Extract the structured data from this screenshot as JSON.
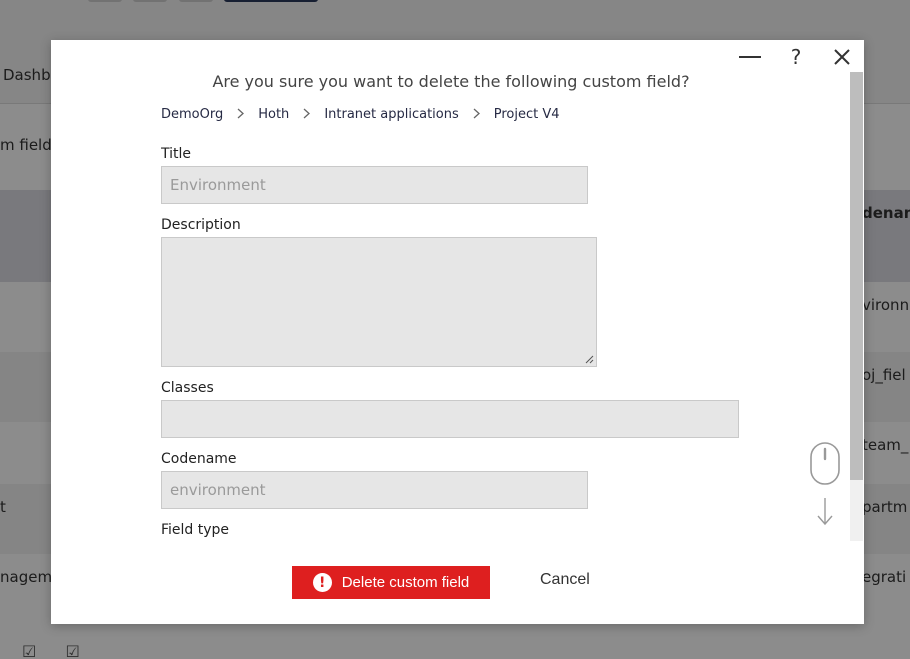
{
  "background": {
    "nav_label": "Dashb",
    "sub_label": "m field",
    "header_col_right": "denam",
    "rows_right": [
      "vironn",
      "oj_fiel",
      "team_",
      "partm",
      "egrati"
    ],
    "rows_left": [
      "",
      "",
      "",
      "t",
      "nagem"
    ]
  },
  "dialog": {
    "title": "Are you sure you want to delete the following custom field?",
    "controls": {
      "minimize_icon": "minimize-icon",
      "help_icon": "help-icon",
      "help_glyph": "?",
      "close_icon": "close-icon"
    },
    "breadcrumb": [
      "DemoOrg",
      "Hoth",
      "Intranet applications",
      "Project V4"
    ],
    "form": {
      "title_label": "Title",
      "title_value": "Environment",
      "description_label": "Description",
      "description_value": "",
      "classes_label": "Classes",
      "classes_value": "",
      "codename_label": "Codename",
      "codename_value": "environment",
      "field_type_label": "Field type"
    },
    "buttons": {
      "delete_label": "Delete custom field",
      "cancel_label": "Cancel"
    },
    "colors": {
      "danger": "#de1f1f",
      "overlay": "#000000"
    }
  }
}
